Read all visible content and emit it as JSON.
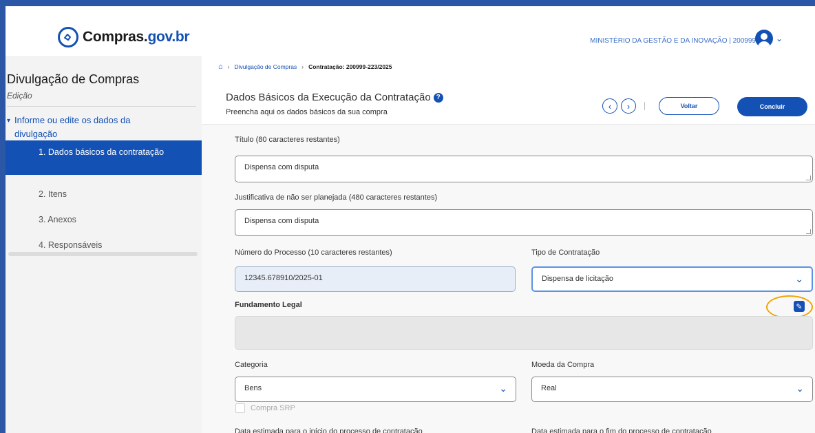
{
  "header": {
    "logo_text": "Compras.",
    "logo_suffix": "gov.br",
    "ministry": "MINISTÉRIO DA GESTÃO E DA INOVAÇÃO | 200999"
  },
  "sidebar": {
    "title": "Divulgação de Compras",
    "subtitle": "Edição",
    "section": "Informe ou edite os dados da divulgação",
    "items": [
      {
        "label": "1.  Dados básicos da contratação",
        "active": true
      },
      {
        "label": "2.  Itens"
      },
      {
        "label": "3.  Anexos"
      },
      {
        "label": "4.  Responsáveis"
      }
    ]
  },
  "breadcrumb": {
    "home_icon": "home-icon",
    "items": [
      "Divulgação de Compras",
      "Contratação: 200999-223/2025"
    ]
  },
  "page": {
    "title": "Dados Básicos da Execução da Contratação",
    "description": "Preencha aqui os dados básicos da sua compra",
    "back_label": "Voltar",
    "finish_label": "Concluir"
  },
  "form": {
    "titulo_label": "Título (80 caracteres restantes)",
    "titulo_value": "Dispensa com disputa",
    "justificativa_label": "Justificativa de não ser planejada (480 caracteres restantes)",
    "justificativa_value": "Dispensa com disputa",
    "processo_label": "Número do Processo (10 caracteres restantes)",
    "processo_value": "12345.678910/2025-01",
    "tipo_label": "Tipo de Contratação",
    "tipo_value": "Dispensa de licitação",
    "fundamento_label": "Fundamento Legal",
    "categoria_label": "Categoria",
    "categoria_value": "Bens",
    "moeda_label": "Moeda da Compra",
    "moeda_value": "Real",
    "srp_label": "Compra SRP",
    "data_inicio_label": "Data estimada para o início do processo de contratação",
    "data_fim_label": "Data estimada para o fim do processo de contratação"
  },
  "colors": {
    "primary": "#1351b4",
    "frame": "#2c56a6",
    "highlight": "#f0a500"
  }
}
